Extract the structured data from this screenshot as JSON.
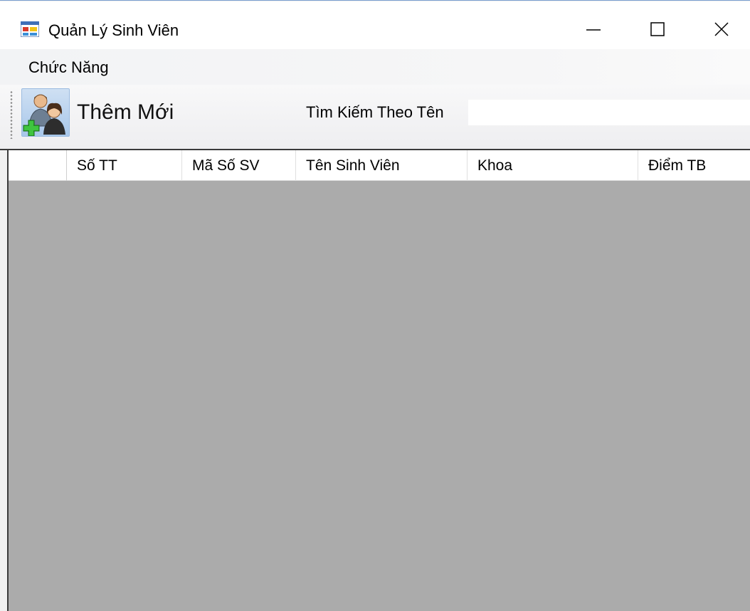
{
  "window": {
    "title": "Quản Lý Sinh Viên",
    "controls": {
      "minimize": "minimize",
      "maximize": "maximize",
      "close": "close"
    }
  },
  "menu": {
    "items": [
      {
        "label": "Chức Năng"
      }
    ]
  },
  "toolbar": {
    "add_label": "Thêm Mới",
    "add_icon": "users-add-icon",
    "search_label": "Tìm Kiếm Theo Tên",
    "search_value": "",
    "search_placeholder": ""
  },
  "grid": {
    "columns": [
      "Số TT",
      "Mã Số SV",
      "Tên Sinh Viên",
      "Khoa",
      "Điểm TB"
    ],
    "rows": [],
    "empty_color": "#ababab"
  },
  "colors": {
    "title_bar": "#ffffff",
    "window_bg": "#f0f0f0",
    "grid_bg": "#ababab",
    "add_icon_plus": "#2fae2f"
  }
}
